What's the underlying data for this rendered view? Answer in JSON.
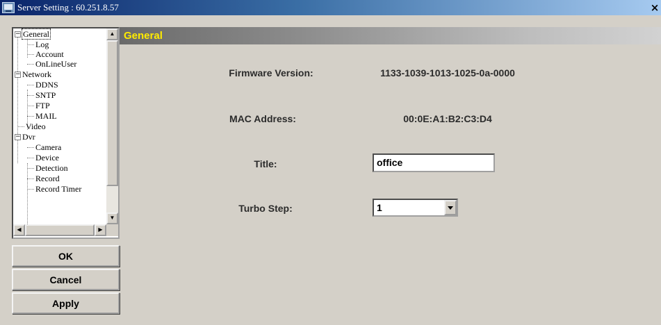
{
  "window": {
    "title": "Server Setting : 60.251.8.57",
    "close_glyph": "×"
  },
  "tree": {
    "items": [
      {
        "label": "General",
        "expander": "−",
        "selected": true
      },
      {
        "label": "Log"
      },
      {
        "label": "Account"
      },
      {
        "label": "OnLineUser"
      },
      {
        "label": "Network",
        "expander": "−"
      },
      {
        "label": "DDNS"
      },
      {
        "label": "SNTP"
      },
      {
        "label": "FTP"
      },
      {
        "label": "MAIL"
      },
      {
        "label": "Video"
      },
      {
        "label": "Dvr",
        "expander": "−"
      },
      {
        "label": "Camera"
      },
      {
        "label": "Device"
      },
      {
        "label": "Detection"
      },
      {
        "label": "Record"
      },
      {
        "label": "Record Timer"
      }
    ]
  },
  "buttons": {
    "ok": "OK",
    "cancel": "Cancel",
    "apply": "Apply"
  },
  "section": {
    "title": "General"
  },
  "fields": {
    "firmware_label": "Firmware Version:",
    "firmware_value": "1133-1039-1013-1025-0a-0000",
    "mac_label": "MAC Address:",
    "mac_value": "00:0E:A1:B2:C3:D4",
    "title_label": "Title:",
    "title_value": "office",
    "turbo_label": "Turbo Step:",
    "turbo_value": "1"
  },
  "colors": {
    "section_title": "#ffeb00",
    "titlebar_start": "#0a246a",
    "window_bg": "#d4d0c8"
  }
}
